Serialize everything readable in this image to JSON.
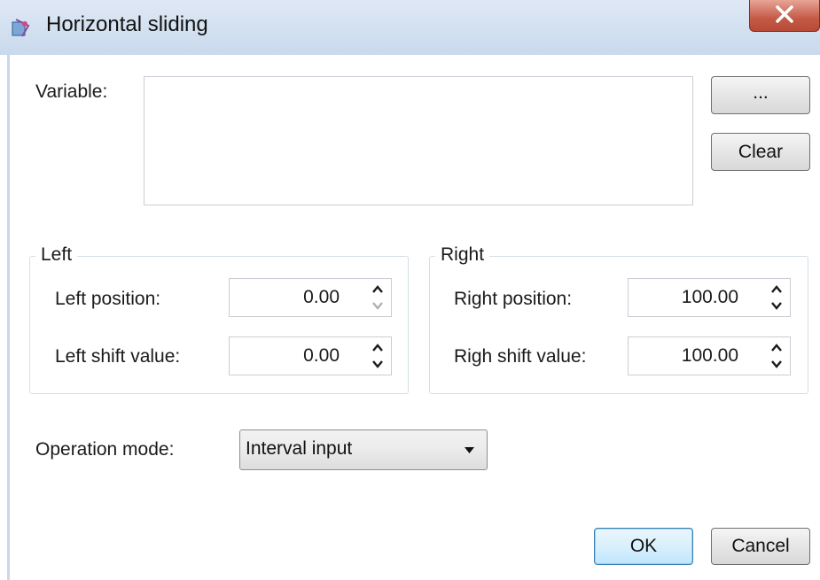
{
  "window": {
    "title": "Horizontal sliding",
    "app_icon": "app-icon",
    "close_icon": "close-icon"
  },
  "variable": {
    "label": "Variable:",
    "value": "",
    "browse_label": "...",
    "clear_label": "Clear"
  },
  "left_group": {
    "title": "Left",
    "position_label": "Left position:",
    "position_value": "0.00",
    "shift_label": "Left shift value:",
    "shift_value": "0.00"
  },
  "right_group": {
    "title": "Right",
    "position_label": "Right position:",
    "position_value": "100.00",
    "shift_label": "Righ shift value:",
    "shift_value": "100.00"
  },
  "operation": {
    "label": "Operation mode:",
    "selected": "Interval input"
  },
  "footer": {
    "ok_label": "OK",
    "cancel_label": "Cancel"
  },
  "colors": {
    "titlebar": "#c9d9ec",
    "close": "#c45a46",
    "ok_border": "#3c7fb1",
    "disabled_arrow": "#b0b0b0"
  }
}
